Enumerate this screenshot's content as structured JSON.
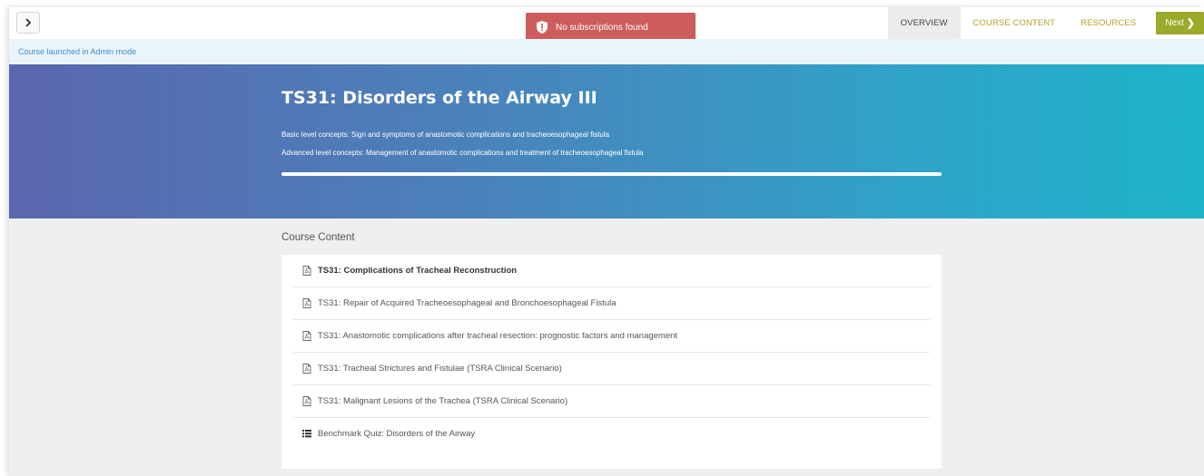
{
  "toast": {
    "message": "No subscriptions found",
    "icon": "shield-alert-icon",
    "color": "#cd5c5c"
  },
  "nav": {
    "tabs": [
      {
        "label": "OVERVIEW",
        "active": true
      },
      {
        "label": "COURSE CONTENT",
        "active": false
      },
      {
        "label": "RESOURCES",
        "active": false
      }
    ],
    "next_label": "Next",
    "accent": "#b8a027",
    "next_bg": "#9caa2c"
  },
  "admin_notice": "Course launched in Admin mode",
  "hero": {
    "title": "TS31: Disorders of the Airway III",
    "basic_concepts": "Basic level concepts: Sign and symptoms of anastomotic complications and tracheoesophageal fistula",
    "advanced_concepts": "Advanced level concepts: Management of anastomotic complications and treatment of tracheoesophageal fistula",
    "progress": 1.0
  },
  "content": {
    "heading": "Course Content",
    "items": [
      {
        "label": "TS31: Complications of Tracheal Reconstruction",
        "icon": "pdf-icon",
        "bold": true
      },
      {
        "label": "TS31: Repair of Acquired Tracheoesophageal and Bronchoesophageal Fistula",
        "icon": "pdf-icon",
        "bold": false
      },
      {
        "label": "TS31: Anastomotic complications after tracheal resection: prognostic factors and management",
        "icon": "pdf-icon",
        "bold": false
      },
      {
        "label": "TS31: Tracheal Strictures and Fistulae (TSRA Clinical Scenario)",
        "icon": "pdf-icon",
        "bold": false
      },
      {
        "label": "TS31: Malignant Lesions of the Trachea (TSRA Clinical Scenario)",
        "icon": "pdf-icon",
        "bold": false
      },
      {
        "label": "Benchmark Quiz: Disorders of the Airway",
        "icon": "list-icon",
        "bold": false
      }
    ]
  }
}
